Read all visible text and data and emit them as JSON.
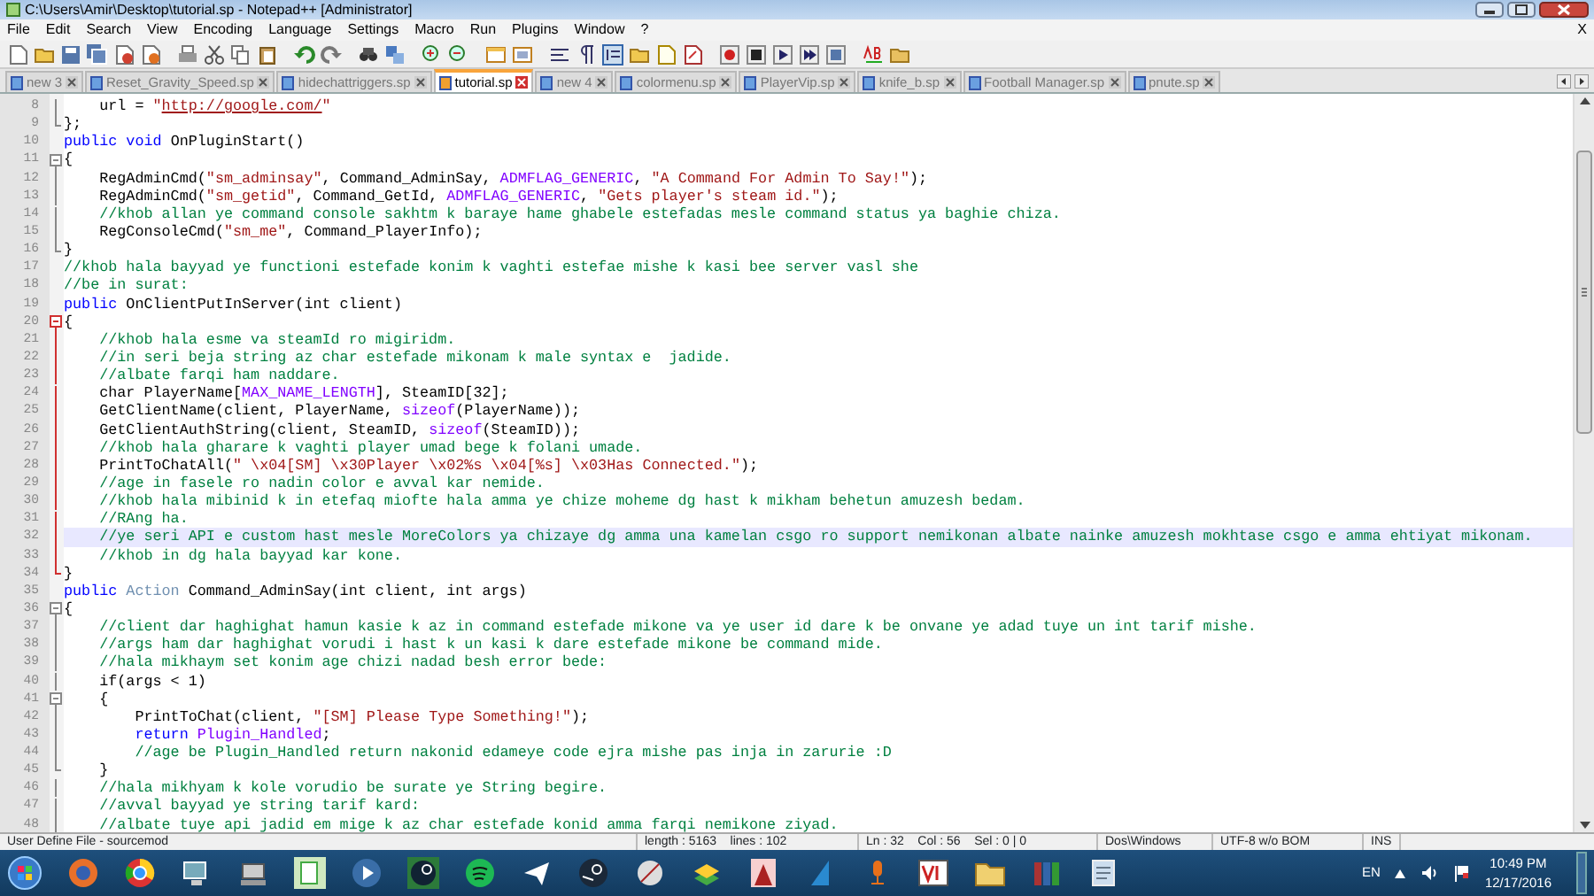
{
  "window": {
    "title": "C:\\Users\\Amir\\Desktop\\tutorial.sp - Notepad++ [Administrator]"
  },
  "menu": [
    "File",
    "Edit",
    "Search",
    "View",
    "Encoding",
    "Language",
    "Settings",
    "Macro",
    "Run",
    "Plugins",
    "Window",
    "?"
  ],
  "menu_close": "X",
  "tabs": [
    {
      "label": "new  3",
      "selected": false
    },
    {
      "label": "Reset_Gravity_Speed.sp",
      "selected": false
    },
    {
      "label": "hidechattriggers.sp",
      "selected": false
    },
    {
      "label": "tutorial.sp",
      "selected": true
    },
    {
      "label": "new  4",
      "selected": false
    },
    {
      "label": "colormenu.sp",
      "selected": false
    },
    {
      "label": "PlayerVip.sp",
      "selected": false
    },
    {
      "label": "knife_b.sp",
      "selected": false
    },
    {
      "label": "Football Manager.sp",
      "selected": false
    },
    {
      "label": "pnute.sp",
      "selected": false
    }
  ],
  "editor": {
    "lines": [
      {
        "number": "8",
        "kind": "body",
        "tokens": [
          {
            "kind": "plain",
            "text": "    url = "
          },
          {
            "kind": "str",
            "text": "\""
          },
          {
            "kind": "url",
            "text": "http://google.com/"
          },
          {
            "kind": "str",
            "text": "\""
          }
        ]
      },
      {
        "number": "9",
        "kind": "close",
        "tokens": [
          {
            "kind": "plain",
            "text": "};"
          }
        ]
      },
      {
        "number": "10",
        "kind": "plain",
        "tokens": [
          {
            "kind": "kw",
            "text": "public void"
          },
          {
            "kind": "plain",
            "text": " OnPluginStart()"
          }
        ]
      },
      {
        "number": "11",
        "kind": "open",
        "tokens": [
          {
            "kind": "plain",
            "text": "{"
          }
        ]
      },
      {
        "number": "12",
        "kind": "body",
        "tokens": [
          {
            "kind": "plain",
            "text": "    RegAdminCmd("
          },
          {
            "kind": "str",
            "text": "\"sm_adminsay\""
          },
          {
            "kind": "plain",
            "text": ", Command_AdminSay, "
          },
          {
            "kind": "const",
            "text": "ADMFLAG_GENERIC"
          },
          {
            "kind": "plain",
            "text": ", "
          },
          {
            "kind": "str",
            "text": "\"A Command For Admin To Say!\""
          },
          {
            "kind": "plain",
            "text": ");"
          }
        ]
      },
      {
        "number": "13",
        "kind": "body",
        "tokens": [
          {
            "kind": "plain",
            "text": "    RegAdminCmd("
          },
          {
            "kind": "str",
            "text": "\"sm_getid\""
          },
          {
            "kind": "plain",
            "text": ", Command_GetId, "
          },
          {
            "kind": "const",
            "text": "ADMFLAG_GENERIC"
          },
          {
            "kind": "plain",
            "text": ", "
          },
          {
            "kind": "str",
            "text": "\"Gets player's steam id.\""
          },
          {
            "kind": "plain",
            "text": ");"
          }
        ]
      },
      {
        "number": "14",
        "kind": "body",
        "tokens": [
          {
            "kind": "cm",
            "text": "    //khob allan ye command console sakhtm k baraye hame ghabele estefadas mesle command status ya baghie chiza."
          }
        ]
      },
      {
        "number": "15",
        "kind": "body",
        "tokens": [
          {
            "kind": "plain",
            "text": "    RegConsoleCmd("
          },
          {
            "kind": "str",
            "text": "\"sm_me\""
          },
          {
            "kind": "plain",
            "text": ", Command_PlayerInfo);"
          }
        ]
      },
      {
        "number": "16",
        "kind": "close",
        "tokens": [
          {
            "kind": "plain",
            "text": "}"
          }
        ]
      },
      {
        "number": "17",
        "kind": "plain",
        "tokens": [
          {
            "kind": "cm",
            "text": "//khob hala bayyad ye functioni estefade konim k vaghti estefae mishe k kasi bee server vasl she"
          }
        ]
      },
      {
        "number": "18",
        "kind": "plain",
        "tokens": [
          {
            "kind": "cm",
            "text": "//be in surat:"
          }
        ]
      },
      {
        "number": "19",
        "kind": "plain",
        "tokens": [
          {
            "kind": "kw",
            "text": "public"
          },
          {
            "kind": "plain",
            "text": " OnClientPutInServer(int client)"
          }
        ]
      },
      {
        "number": "20",
        "kind": "open",
        "active": true,
        "tokens": [
          {
            "kind": "plain",
            "text": "{"
          }
        ]
      },
      {
        "number": "21",
        "kind": "body",
        "active": true,
        "tokens": [
          {
            "kind": "cm",
            "text": "    //khob hala esme va steamId ro migiridm."
          }
        ]
      },
      {
        "number": "22",
        "kind": "body",
        "active": true,
        "tokens": [
          {
            "kind": "cm",
            "text": "    //in seri beja string az char estefade mikonam k male syntax e  jadide."
          }
        ]
      },
      {
        "number": "23",
        "kind": "body",
        "active": true,
        "tokens": [
          {
            "kind": "cm",
            "text": "    //albate farqi ham naddare."
          }
        ]
      },
      {
        "number": "24",
        "kind": "body",
        "active": true,
        "tokens": [
          {
            "kind": "plain",
            "text": "    char PlayerName["
          },
          {
            "kind": "const",
            "text": "MAX_NAME_LENGTH"
          },
          {
            "kind": "plain",
            "text": "], SteamID[32];"
          }
        ]
      },
      {
        "number": "25",
        "kind": "body",
        "active": true,
        "tokens": [
          {
            "kind": "plain",
            "text": "    GetClientName(client, PlayerName, "
          },
          {
            "kind": "const",
            "text": "sizeof"
          },
          {
            "kind": "plain",
            "text": "(PlayerName));"
          }
        ]
      },
      {
        "number": "26",
        "kind": "body",
        "active": true,
        "tokens": [
          {
            "kind": "plain",
            "text": "    GetClientAuthString(client, SteamID, "
          },
          {
            "kind": "const",
            "text": "sizeof"
          },
          {
            "kind": "plain",
            "text": "(SteamID));"
          }
        ]
      },
      {
        "number": "27",
        "kind": "body",
        "active": true,
        "tokens": [
          {
            "kind": "cm",
            "text": "    //khob hala gharare k vaghti player umad bege k folani umade."
          }
        ]
      },
      {
        "number": "28",
        "kind": "body",
        "active": true,
        "tokens": [
          {
            "kind": "plain",
            "text": "    PrintToChatAll("
          },
          {
            "kind": "str",
            "text": "\" \\x04[SM] \\x30Player \\x02%s \\x04[%s] \\x03Has Connected.\""
          },
          {
            "kind": "plain",
            "text": ");"
          }
        ]
      },
      {
        "number": "29",
        "kind": "body",
        "active": true,
        "tokens": [
          {
            "kind": "cm",
            "text": "    //age in fasele ro nadin color e avval kar nemide."
          }
        ]
      },
      {
        "number": "30",
        "kind": "body",
        "active": true,
        "tokens": [
          {
            "kind": "cm",
            "text": "    //khob hala mibinid k in etefaq miofte hala amma ye chize moheme dg hast k mikham behetun amuzesh bedam."
          }
        ]
      },
      {
        "number": "31",
        "kind": "body",
        "active": true,
        "tokens": [
          {
            "kind": "cm",
            "text": "    //RAng ha."
          }
        ]
      },
      {
        "number": "32",
        "kind": "body",
        "active": true,
        "current": true,
        "tokens": [
          {
            "kind": "cm",
            "text": "    //ye seri API e custom hast mesle MoreColors ya chizaye dg amma una kamelan csgo ro support nemikonan albate nainke amuzesh mokhtase csgo e amma ehtiyat mikonam."
          }
        ]
      },
      {
        "number": "33",
        "kind": "body",
        "active": true,
        "tokens": [
          {
            "kind": "cm",
            "text": "    //khob in dg hala bayyad kar kone."
          }
        ]
      },
      {
        "number": "34",
        "kind": "close",
        "active": true,
        "tokens": [
          {
            "kind": "plain",
            "text": "}"
          }
        ]
      },
      {
        "number": "35",
        "kind": "plain",
        "tokens": [
          {
            "kind": "kw",
            "text": "public"
          },
          {
            "kind": "type",
            "text": " Action"
          },
          {
            "kind": "plain",
            "text": " Command_AdminSay(int client, int args)"
          }
        ]
      },
      {
        "number": "36",
        "kind": "open",
        "tokens": [
          {
            "kind": "plain",
            "text": "{"
          }
        ]
      },
      {
        "number": "37",
        "kind": "body",
        "tokens": [
          {
            "kind": "cm",
            "text": "    //client dar haghighat hamun kasie k az in command estefade mikone va ye user id dare k be onvane ye adad tuye un int tarif mishe."
          }
        ]
      },
      {
        "number": "38",
        "kind": "body",
        "tokens": [
          {
            "kind": "cm",
            "text": "    //args ham dar haghighat vorudi i hast k un kasi k dare estefade mikone be command mide."
          }
        ]
      },
      {
        "number": "39",
        "kind": "body",
        "tokens": [
          {
            "kind": "cm",
            "text": "    //hala mikhaym set konim age chizi nadad besh error bede:"
          }
        ]
      },
      {
        "number": "40",
        "kind": "body",
        "tokens": [
          {
            "kind": "plain",
            "text": "    if(args < 1)"
          }
        ]
      },
      {
        "number": "41",
        "kind": "open",
        "tokens": [
          {
            "kind": "plain",
            "text": "    {"
          }
        ]
      },
      {
        "number": "42",
        "kind": "body",
        "tokens": [
          {
            "kind": "plain",
            "text": "        PrintToChat(client, "
          },
          {
            "kind": "str",
            "text": "\"[SM] Please Type Something!\""
          },
          {
            "kind": "plain",
            "text": ");"
          }
        ]
      },
      {
        "number": "43",
        "kind": "body",
        "tokens": [
          {
            "kind": "kw",
            "text": "        return"
          },
          {
            "kind": "const",
            "text": " Plugin_Handled"
          },
          {
            "kind": "plain",
            "text": ";"
          }
        ]
      },
      {
        "number": "44",
        "kind": "body",
        "tokens": [
          {
            "kind": "cm",
            "text": "        //age be Plugin_Handled return nakonid edameye code ejra mishe pas inja in zarurie :D"
          }
        ]
      },
      {
        "number": "45",
        "kind": "close",
        "tokens": [
          {
            "kind": "plain",
            "text": "    }"
          }
        ]
      },
      {
        "number": "46",
        "kind": "body",
        "tokens": [
          {
            "kind": "cm",
            "text": "    //hala mikhyam k kole vorudio be surate ye String begire."
          }
        ]
      },
      {
        "number": "47",
        "kind": "body",
        "tokens": [
          {
            "kind": "cm",
            "text": "    //avval bayyad ye string tarif kard:"
          }
        ]
      },
      {
        "number": "48",
        "kind": "body",
        "tokens": [
          {
            "kind": "cm",
            "text": "    //albate tuye api jadid em mige k az char estefade konid amma farqi nemikone ziyad."
          }
        ]
      }
    ]
  },
  "status_bar": {
    "file_type": "User Define File - sourcemod",
    "length": "length : 5163    lines : 102",
    "position": "Ln : 32    Col : 56    Sel : 0 | 0",
    "eol": "Dos\\Windows",
    "encoding": "UTF-8 w/o BOM",
    "mode": "INS"
  },
  "taskbar": {
    "language": "EN",
    "time": "10:49 PM",
    "date": "12/17/2016"
  }
}
